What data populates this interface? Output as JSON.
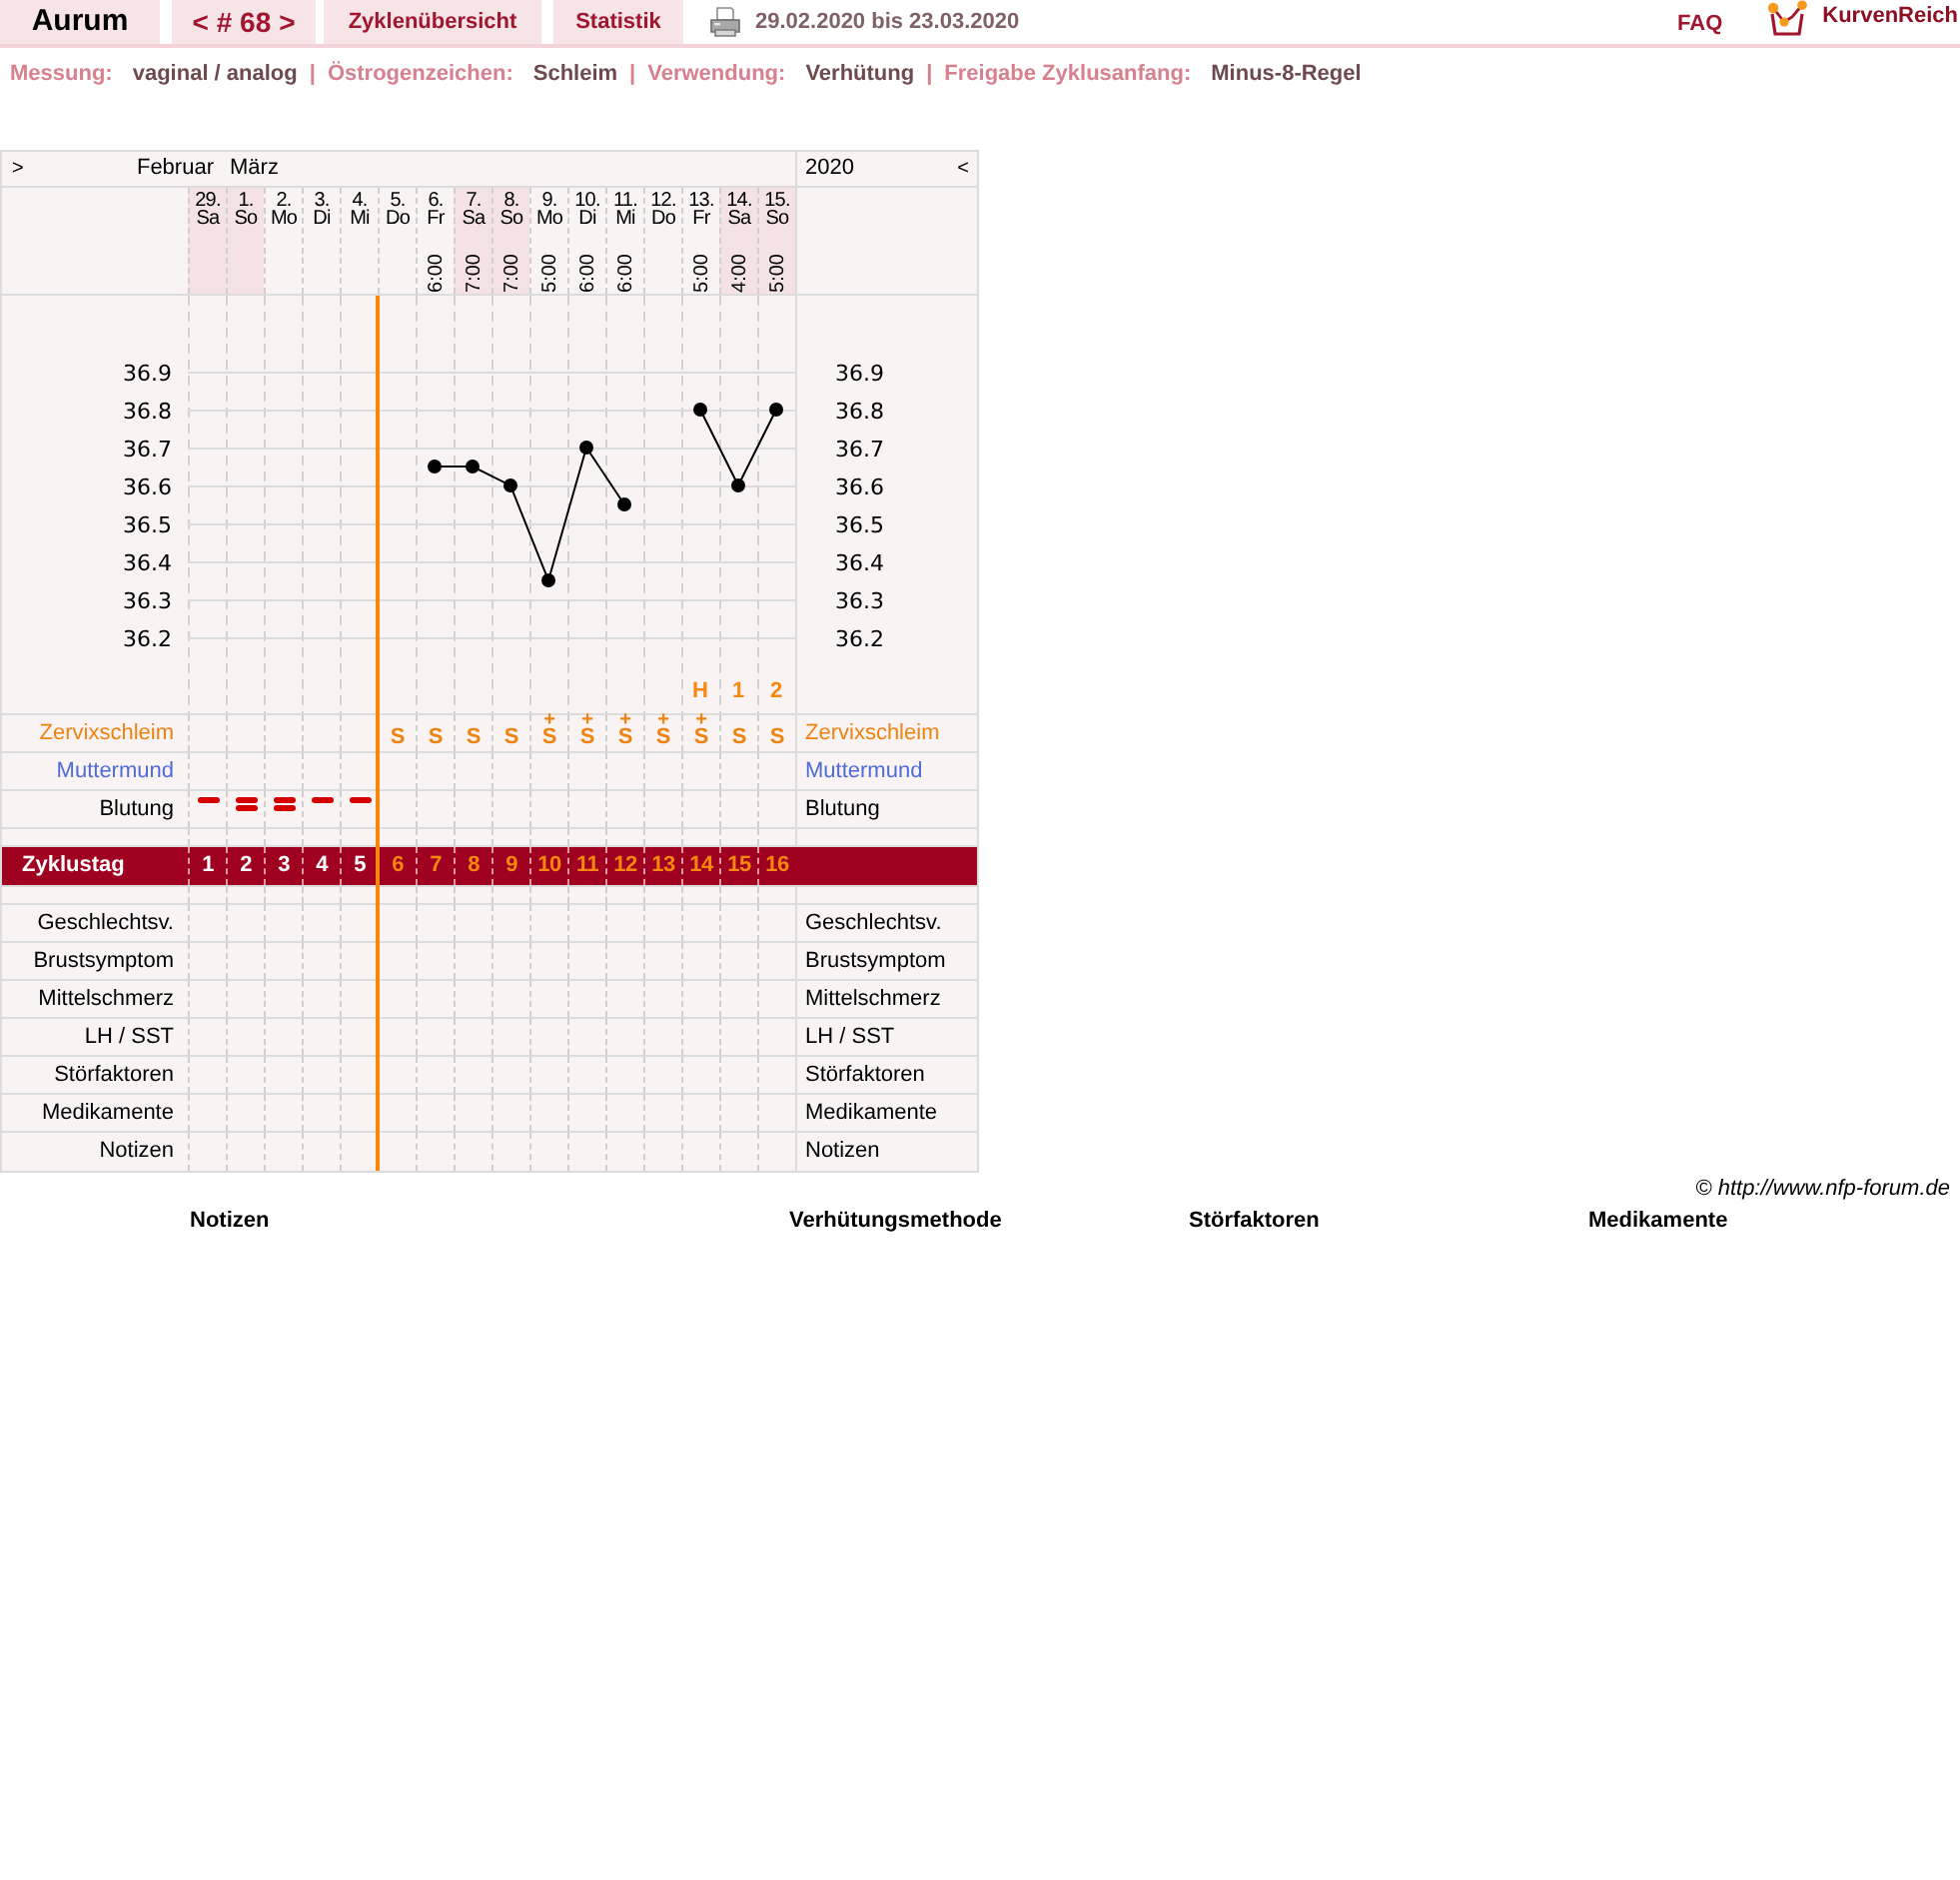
{
  "top_bar": {
    "user": "Aurum",
    "cycle_nav": {
      "prev": "<",
      "number": "# 68",
      "next": ">"
    },
    "links": [
      {
        "label": "Zyklenübersicht"
      },
      {
        "label": "Statistik"
      }
    ],
    "date_range": "29.02.2020 bis 23.03.2020",
    "faq": "FAQ",
    "brand": "KurvenReich"
  },
  "settings": [
    {
      "label": "Messung:",
      "value": "vaginal / analog"
    },
    {
      "separator": "|",
      "label": "Östrogenzeichen:",
      "value": "Schleim"
    },
    {
      "separator": "|",
      "label": "Verwendung:",
      "value": "Verhütung"
    },
    {
      "separator": "|",
      "label": "Freigabe Zyklusanfang:",
      "value": "Minus-8-Regel"
    }
  ],
  "cycle_chart": {
    "scroll_left": ">",
    "months": [
      "Februar",
      "März"
    ],
    "year": "2020",
    "scroll_right": "<",
    "days": [
      {
        "date": "29.",
        "weekday": "Sa",
        "weekend": true,
        "cycle_day": "1",
        "fertile": false,
        "bleeding": {
          "kind": "single"
        }
      },
      {
        "date": "1.",
        "weekday": "So",
        "weekend": true,
        "cycle_day": "2",
        "fertile": false,
        "bleeding": {
          "kind": "double"
        }
      },
      {
        "date": "2.",
        "weekday": "Mo",
        "weekend": false,
        "cycle_day": "3",
        "fertile": false,
        "bleeding": {
          "kind": "double"
        }
      },
      {
        "date": "3.",
        "weekday": "Di",
        "weekend": false,
        "cycle_day": "4",
        "fertile": false,
        "bleeding": {
          "kind": "single"
        }
      },
      {
        "date": "4.",
        "weekday": "Mi",
        "weekend": false,
        "cycle_day": "5",
        "fertile": false,
        "bleeding": {
          "kind": "single"
        }
      },
      {
        "date": "5.",
        "weekday": "Do",
        "weekend": false,
        "cycle_day": "6",
        "fertile": true,
        "mucus": "S"
      },
      {
        "date": "6.",
        "weekday": "Fr",
        "weekend": false,
        "time": "6:00",
        "cycle_day": "7",
        "fertile": true,
        "mucus": "S"
      },
      {
        "date": "7.",
        "weekday": "Sa",
        "weekend": true,
        "time": "7:00",
        "cycle_day": "8",
        "fertile": true,
        "mucus": "S"
      },
      {
        "date": "8.",
        "weekday": "So",
        "weekend": true,
        "time": "7:00",
        "cycle_day": "9",
        "fertile": true,
        "mucus": "S"
      },
      {
        "date": "9.",
        "weekday": "Mo",
        "weekend": false,
        "time": "5:00",
        "cycle_day": "10",
        "fertile": true,
        "mucus": "S",
        "mucus_plus": "+"
      },
      {
        "date": "10.",
        "weekday": "Di",
        "weekend": false,
        "time": "6:00",
        "cycle_day": "11",
        "fertile": true,
        "mucus": "S",
        "mucus_plus": "+"
      },
      {
        "date": "11.",
        "weekday": "Mi",
        "weekend": false,
        "time": "6:00",
        "cycle_day": "12",
        "fertile": true,
        "mucus": "S",
        "mucus_plus": "+"
      },
      {
        "date": "12.",
        "weekday": "Do",
        "weekend": false,
        "cycle_day": "13",
        "fertile": true,
        "mucus": "S",
        "mucus_plus": "+"
      },
      {
        "date": "13.",
        "weekday": "Fr",
        "weekend": false,
        "time": "5:00",
        "cycle_day": "14",
        "fertile": true,
        "mucus": "S",
        "mucus_plus": "+",
        "marker": "H"
      },
      {
        "date": "14.",
        "weekday": "Sa",
        "weekend": true,
        "time": "4:00",
        "cycle_day": "15",
        "fertile": true,
        "mucus": "S",
        "marker": "1"
      },
      {
        "date": "15.",
        "weekday": "So",
        "weekend": true,
        "time": "5:00",
        "cycle_day": "16",
        "fertile": true,
        "mucus": "S",
        "marker": "2"
      }
    ],
    "chart_data": {
      "type": "line",
      "ylim": [
        36.0,
        37.1
      ],
      "yticks": [
        36.2,
        36.3,
        36.4,
        36.5,
        36.6,
        36.7,
        36.8,
        36.9
      ],
      "grid": true,
      "series": [
        {
          "color": "#000000",
          "marker": "circle",
          "values": [
            null,
            null,
            null,
            null,
            null,
            null,
            36.65,
            36.65,
            36.6,
            36.35,
            36.7,
            36.55,
            null,
            36.8,
            36.6,
            36.8
          ]
        }
      ]
    },
    "right_scale": [
      "36.9",
      "36.8",
      "36.7",
      "36.6",
      "36.5",
      "36.4",
      "36.3",
      "36.2"
    ],
    "observation_rows": [
      {
        "label": "Zervixschleim",
        "label_right": "Zervixschleim",
        "kind": "mucus",
        "color": "#f0820f"
      },
      {
        "label": "Muttermund",
        "label_right": "Muttermund",
        "kind": "cervix",
        "color": "#4f6bd8"
      },
      {
        "label": "Blutung",
        "label_right": "Blutung",
        "kind": "bleeding",
        "color": "#000000"
      }
    ],
    "cycle_day_label": "Zyklustag",
    "symptom_rows": [
      {
        "label": "Geschlechtsv.",
        "label_right": "Geschlechtsv."
      },
      {
        "label": "Brustsymptom",
        "label_right": "Brustsymptom"
      },
      {
        "label": "Mittelschmerz",
        "label_right": "Mittelschmerz"
      },
      {
        "label": "LH / SST",
        "label_right": "LH / SST"
      },
      {
        "label": "Störfaktoren",
        "label_right": "Störfaktoren"
      },
      {
        "label": "Medikamente",
        "label_right": "Medikamente"
      },
      {
        "label": "Notizen",
        "label_right": "Notizen"
      }
    ]
  },
  "copyright": "© http://www.nfp-forum.de",
  "sections": [
    "Notizen",
    "Verhütungsmethode",
    "Störfaktoren",
    "Medikamente"
  ]
}
